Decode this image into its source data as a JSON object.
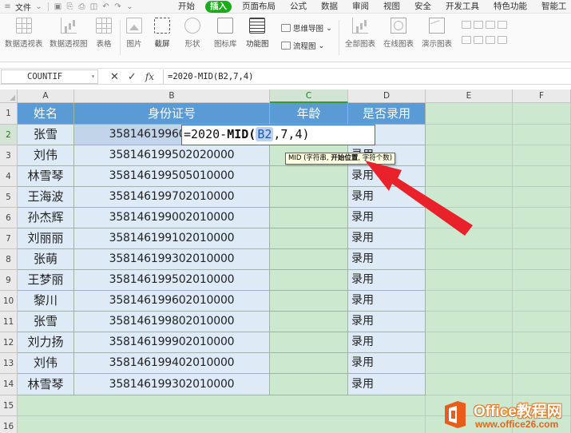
{
  "menu": {
    "file_label": "文件",
    "tabs": [
      {
        "label": "开始",
        "active": false
      },
      {
        "label": "插入",
        "active": true
      },
      {
        "label": "页面布局",
        "active": false
      },
      {
        "label": "公式",
        "active": false
      },
      {
        "label": "数据",
        "active": false
      },
      {
        "label": "审阅",
        "active": false
      },
      {
        "label": "视图",
        "active": false
      },
      {
        "label": "安全",
        "active": false
      },
      {
        "label": "开发工具",
        "active": false
      },
      {
        "label": "特色功能",
        "active": false
      },
      {
        "label": "智能工",
        "active": false
      }
    ],
    "active_color": "#1aad19"
  },
  "ribbon": {
    "pivot_table": "数据透视表",
    "pivot_chart": "数据透视图",
    "table": "表格",
    "picture": "图片",
    "screenshot": "截屏",
    "shape": "形状",
    "icon_lib": "图标库",
    "function_chart": "功能图",
    "mindmap": "思维导图",
    "flowchart": "流程图",
    "all_charts": "全部图表",
    "online_charts": "在线图表",
    "demo_chart": "演示图表"
  },
  "formula_bar": {
    "name_box": "COUNTIF",
    "cancel": "✕",
    "confirm": "✓",
    "fx": "fx",
    "formula": "=2020-MID(B2,7,4)"
  },
  "sheet": {
    "columns": [
      "A",
      "B",
      "C",
      "D",
      "E",
      "F"
    ],
    "rows": [
      "1",
      "2",
      "3",
      "4",
      "5",
      "6",
      "7",
      "8",
      "9",
      "10",
      "11",
      "12",
      "13",
      "14",
      "15",
      "16"
    ],
    "header_row": [
      "姓名",
      "身份证号",
      "年龄",
      "是否录用"
    ],
    "data": [
      {
        "name": "张雪",
        "id": "358146199602010000",
        "status": ""
      },
      {
        "name": "刘伟",
        "id": "358146199502020000",
        "status": "录用"
      },
      {
        "name": "林雪琴",
        "id": "358146199505010000",
        "status": "录用"
      },
      {
        "name": "王海波",
        "id": "358146199702010000",
        "status": "录用"
      },
      {
        "name": "孙杰辉",
        "id": "358146199002010000",
        "status": "录用"
      },
      {
        "name": "刘丽丽",
        "id": "358146199102010000",
        "status": "录用"
      },
      {
        "name": "张萌",
        "id": "358146199302010000",
        "status": "录用"
      },
      {
        "name": "王梦丽",
        "id": "358146199502010000",
        "status": "录用"
      },
      {
        "name": "黎川",
        "id": "358146199602010000",
        "status": "录用"
      },
      {
        "name": "张雪",
        "id": "358146199802010000",
        "status": "录用"
      },
      {
        "name": "刘力扬",
        "id": "358146199902010000",
        "status": "录用"
      },
      {
        "name": "刘伟",
        "id": "358146199402010000",
        "status": "录用"
      },
      {
        "name": "林雪琴",
        "id": "358146199302010000",
        "status": "录用"
      }
    ],
    "edit": {
      "prefix": "=2020-",
      "fn": "MID(",
      "ref": "B2",
      "suffix": ",7,4)"
    },
    "tooltip": {
      "fn": "MID",
      "args": " (字符串, ",
      "bold_arg": "开始位置",
      "rest": ", 字符个数)"
    },
    "colors": {
      "header_bg": "#5b9bd5",
      "row_bg": "#deebf7",
      "sheet_bg": "#cce8cf",
      "arrow": "#e8212a"
    }
  },
  "watermark": {
    "title": "Office教程网",
    "url": "www.office26.com"
  }
}
